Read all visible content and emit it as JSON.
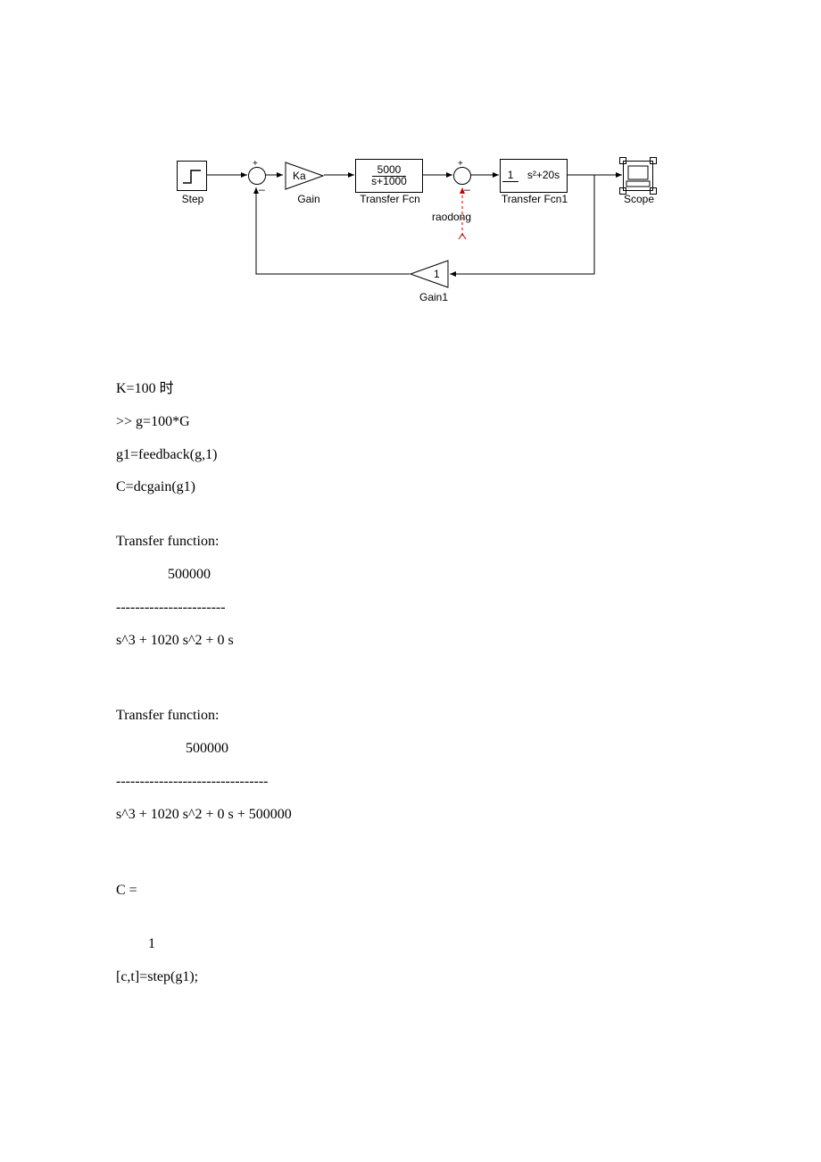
{
  "diagram": {
    "step_label": "Step",
    "gain_value": "Ka",
    "gain_label": "Gain",
    "tf1_num": "5000",
    "tf1_den": "s+1000",
    "tf1_label": "Transfer Fcn",
    "tf2_num": "1",
    "tf2_den": "s²+20s",
    "tf2_label": "Transfer Fcn1",
    "scope_label": "Scope",
    "gain1_value": "1",
    "gain1_label": "Gain1",
    "disturb_label": "raodong"
  },
  "text": {
    "l1": "K=100 时",
    "l2": ">> g=100*G",
    "l3": "g1=feedback(g,1)",
    "l4": "C=dcgain(g1)",
    "tf_header": "Transfer function:",
    "num1": "500000",
    "sep1": "-----------------------",
    "den1": "s^3 + 1020 s^2 + 0 s",
    "num2": "500000",
    "sep2": "--------------------------------",
    "den2": "s^3 + 1020 s^2 + 0 s + 500000",
    "c_eq": "C =",
    "c_val": "1",
    "last": "[c,t]=step(g1);"
  }
}
